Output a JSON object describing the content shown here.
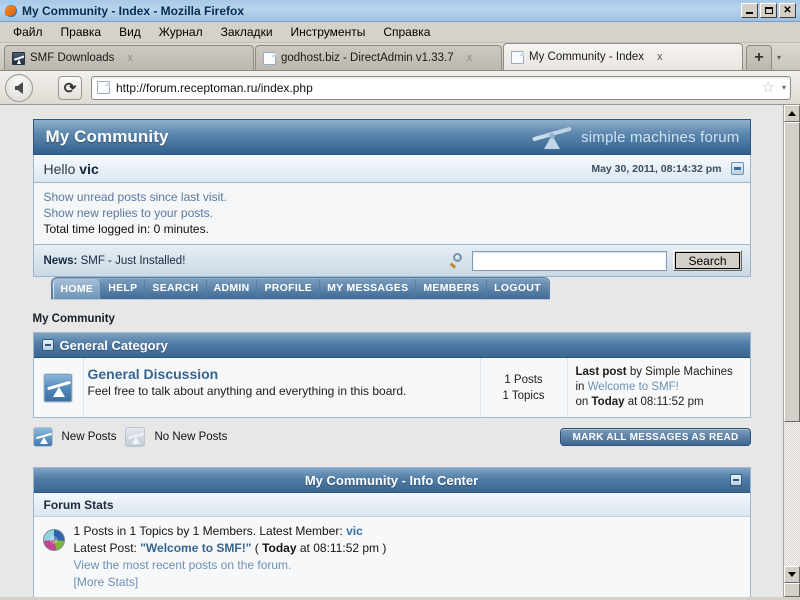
{
  "window": {
    "title": "My Community - Index - Mozilla Firefox",
    "minimize_label": "_",
    "maximize_label": "□",
    "close_label": "✕"
  },
  "menubar": {
    "items": [
      {
        "label": "Файл"
      },
      {
        "label": "Правка"
      },
      {
        "label": "Вид"
      },
      {
        "label": "Журнал"
      },
      {
        "label": "Закладки"
      },
      {
        "label": "Инструменты"
      },
      {
        "label": "Справка"
      }
    ]
  },
  "tabs": {
    "items": [
      {
        "label": "SMF Downloads",
        "icon": "smf-favicon",
        "active": false,
        "close_label": "x"
      },
      {
        "label": "godhost.biz - DirectAdmin v1.33.7",
        "icon": "document-favicon",
        "active": false,
        "close_label": "x"
      },
      {
        "label": "My Community - Index",
        "icon": "document-favicon",
        "active": true,
        "close_label": "x"
      }
    ],
    "new_tab_label": "+",
    "list_all_label": "▾"
  },
  "navbar": {
    "back_title": "Back",
    "forward_title": "Forward",
    "reload_label": "⟳",
    "url": "http://forum.receptoman.ru/index.php",
    "star_label": "☆",
    "star_drop_label": "▾"
  },
  "forum": {
    "name": "My Community",
    "brand": "simple machines forum",
    "greeting_prefix": "Hello",
    "greeting_user": "vic",
    "date": "May 30, 2011, 08:14:32 pm",
    "user_links": [
      "Show unread posts since last visit.",
      "Show new replies to your posts."
    ],
    "time_logged": "Total time logged in: 0 minutes.",
    "news_label": "News:",
    "news_text": "SMF - Just Installed!",
    "search_value": "",
    "search_button": "Search",
    "menu_tabs": [
      {
        "label": "HOME",
        "selected": true
      },
      {
        "label": "HELP",
        "selected": false
      },
      {
        "label": "SEARCH",
        "selected": false
      },
      {
        "label": "ADMIN",
        "selected": false
      },
      {
        "label": "PROFILE",
        "selected": false
      },
      {
        "label": "MY MESSAGES",
        "selected": false
      },
      {
        "label": "MEMBERS",
        "selected": false
      },
      {
        "label": "LOGOUT",
        "selected": false
      }
    ],
    "breadcrumb": "My Community",
    "category": {
      "title": "General Category",
      "board": {
        "title": "General Discussion",
        "description": "Feel free to talk about anything and everything in this board.",
        "posts": "1 Posts",
        "topics": "1 Topics",
        "last_post_label": "Last post",
        "last_post_by": "by Simple Machines",
        "last_post_in_prefix": "in",
        "last_post_topic": "Welcome to SMF!",
        "last_post_on_prefix": "on",
        "last_post_day": "Today",
        "last_post_at": "at 08:11:52 pm"
      }
    },
    "legend": {
      "new_posts": "New Posts",
      "no_new_posts": "No New Posts",
      "mark_all_read": "MARK ALL MESSAGES AS READ"
    },
    "info_center": {
      "title": "My Community - Info Center",
      "section": "Forum Stats",
      "stats_line_prefix": "1 Posts in 1 Topics by 1 Members. Latest Member:",
      "latest_member": "vic",
      "latest_post_label": "Latest Post:",
      "latest_post_title": "\"Welcome to SMF!\"",
      "latest_post_paren_open": "(",
      "latest_post_day": "Today",
      "latest_post_at": "at 08:11:52 pm",
      "latest_post_paren_close": ")",
      "view_recent": "View the most recent posts on the forum.",
      "more_stats": "[More Stats]"
    }
  }
}
